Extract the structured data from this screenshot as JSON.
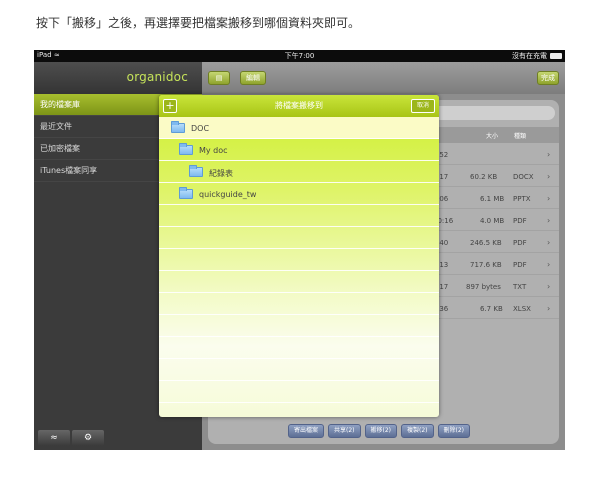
{
  "instruction": "按下「搬移」之後，再選擇要把檔案搬移到哪個資料夾即可。",
  "statusbar": {
    "device": "iPad",
    "wifi_icon": "wifi-icon",
    "time": "下午7:00",
    "charging": "沒有在充電",
    "battery_icon": "battery-icon"
  },
  "sidebar": {
    "logo": "organidoc",
    "items": [
      {
        "label": "我的檔案庫",
        "active": true
      },
      {
        "label": "最近文件",
        "active": false
      },
      {
        "label": "已加密檔案",
        "active": false
      },
      {
        "label": "iTunes檔案同享",
        "active": false
      }
    ],
    "bottom_buttons": [
      {
        "icon": "wifi-icon"
      },
      {
        "icon": "gear-icon"
      }
    ]
  },
  "main": {
    "toolbar": {
      "left_button": "▤",
      "second_button": "編輯",
      "right_button": "完成"
    },
    "columns": {
      "size": "大小",
      "type": "種類"
    },
    "rows": [
      {
        "date": ":52",
        "size": "",
        "type": ""
      },
      {
        "date": ":17",
        "size": "60.2 KB",
        "type": "DOCX"
      },
      {
        "date": ":06",
        "size": "6.1 MB",
        "type": "PPTX"
      },
      {
        "date": "10:16",
        "size": "4.0 MB",
        "type": "PDF"
      },
      {
        "date": ":40",
        "size": "246.5 KB",
        "type": "PDF"
      },
      {
        "date": ":13",
        "size": "717.6 KB",
        "type": "PDF"
      },
      {
        "date": ":17",
        "size": "897 bytes",
        "type": "TXT"
      },
      {
        "date": ":36",
        "size": "6.7 KB",
        "type": "XLSX"
      }
    ],
    "bottom_buttons": [
      "寄出檔案",
      "共享(2)",
      "搬移(2)",
      "複製(2)",
      "刪除(2)"
    ]
  },
  "modal": {
    "title": "將檔案搬移到",
    "add_label": "+",
    "close_label": "取消",
    "folders": [
      {
        "name": "DOC",
        "level": 0,
        "selected": true
      },
      {
        "name": "My doc",
        "level": 1,
        "selected": false
      },
      {
        "name": "紀錄表",
        "level": 2,
        "selected": false
      },
      {
        "name": "quickguide_tw",
        "level": 1,
        "selected": false
      }
    ]
  }
}
